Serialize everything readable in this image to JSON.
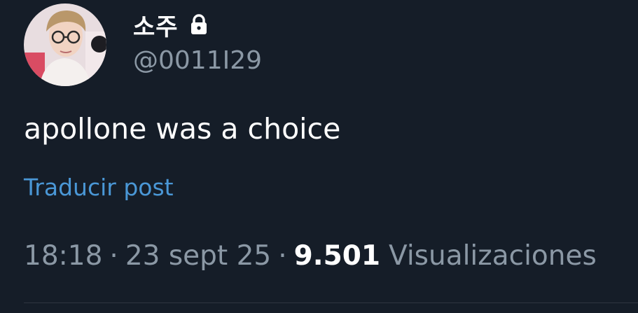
{
  "user": {
    "display_name": "소주",
    "handle": "@0011I29",
    "locked_icon": "lock-icon",
    "avatar_icon": "profile-photo"
  },
  "tweet": {
    "text": "apollone was a choice",
    "translate_label": "Traducir post"
  },
  "meta": {
    "time": "18:18",
    "separator": "·",
    "date": "23 sept 25",
    "views_count": "9.501",
    "views_label": "Visualizaciones"
  },
  "colors": {
    "background": "#151d28",
    "text_primary": "#ffffff",
    "text_secondary": "#8b98a5",
    "link": "#4a97d6"
  }
}
